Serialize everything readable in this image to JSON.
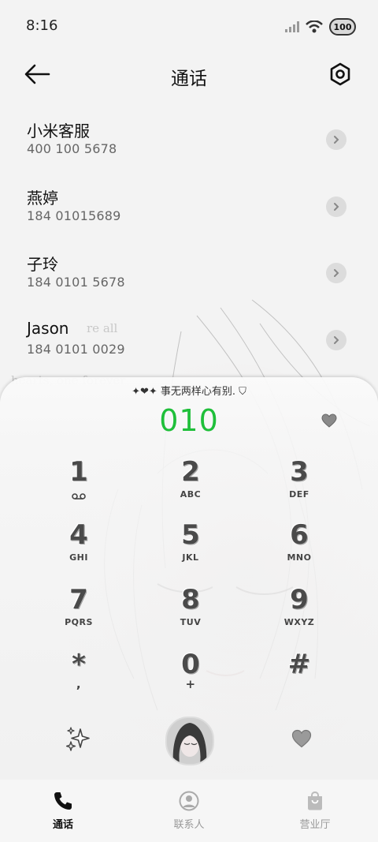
{
  "status_bar": {
    "time": "8:16",
    "battery": "100"
  },
  "header": {
    "title": "通话"
  },
  "contacts": [
    {
      "name": "小米客服",
      "number": "400 100 5678"
    },
    {
      "name": "燕婷",
      "number": "184 01015689"
    },
    {
      "name": "子玲",
      "number": "184 0101 5678"
    },
    {
      "name": "Jason",
      "number": "184 0101 0029"
    }
  ],
  "background_text": [
    "re all",
    "hearts, one forever"
  ],
  "dialer": {
    "slogan": "✦❤✦ 事无两样心有别. ⛉",
    "dialed_number": "010",
    "keys": [
      {
        "digit": "1",
        "letters": ""
      },
      {
        "digit": "2",
        "letters": "ABC"
      },
      {
        "digit": "3",
        "letters": "DEF"
      },
      {
        "digit": "4",
        "letters": "GHI"
      },
      {
        "digit": "5",
        "letters": "JKL"
      },
      {
        "digit": "6",
        "letters": "MNO"
      },
      {
        "digit": "7",
        "letters": "PQRS"
      },
      {
        "digit": "8",
        "letters": "TUV"
      },
      {
        "digit": "9",
        "letters": "WXYZ"
      },
      {
        "digit": "*",
        "letters": ","
      },
      {
        "digit": "0",
        "letters": "+"
      },
      {
        "digit": "#",
        "letters": ""
      }
    ]
  },
  "bottom_nav": [
    {
      "label": "通话",
      "icon": "phone-icon",
      "active": true
    },
    {
      "label": "联系人",
      "icon": "person-icon",
      "active": false
    },
    {
      "label": "营业厅",
      "icon": "bag-icon",
      "active": false
    }
  ],
  "colors": {
    "accent_green": "#1fbf3a",
    "background": "#f3f3f3"
  }
}
